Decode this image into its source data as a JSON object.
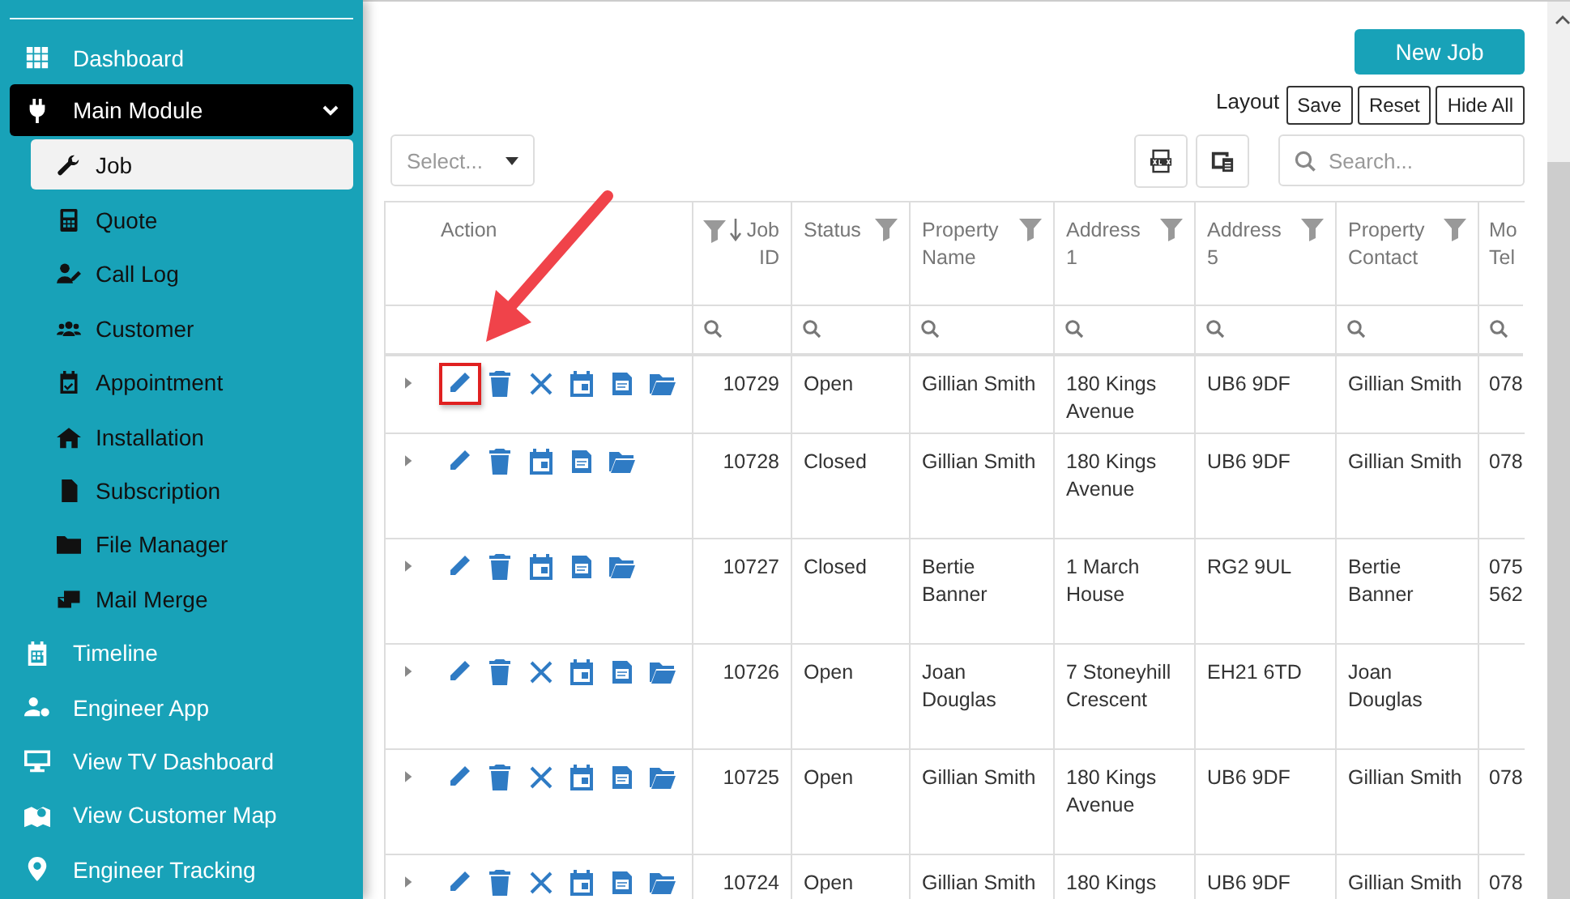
{
  "sidebar": {
    "items": [
      {
        "label": "Dashboard"
      },
      {
        "label": "Main Module",
        "expanded": true,
        "children": [
          {
            "label": "Job",
            "selected": true
          },
          {
            "label": "Quote",
            "selected": false
          },
          {
            "label": "Call Log",
            "selected": false
          },
          {
            "label": "Customer",
            "selected": false
          },
          {
            "label": "Appointment",
            "selected": false
          },
          {
            "label": "Installation",
            "selected": false
          },
          {
            "label": "Subscription",
            "selected": false
          },
          {
            "label": "File Manager",
            "selected": false
          },
          {
            "label": "Mail Merge",
            "selected": false
          }
        ]
      },
      {
        "label": "Timeline"
      },
      {
        "label": "Engineer App"
      },
      {
        "label": "View TV Dashboard"
      },
      {
        "label": "View Customer Map"
      },
      {
        "label": "Engineer Tracking"
      }
    ]
  },
  "toolbar": {
    "new_job": "New Job",
    "layout_label": "Layout",
    "layout_buttons": [
      "Save",
      "Reset",
      "Hide All"
    ],
    "select": {
      "placeholder": "Select..."
    },
    "search": {
      "placeholder": "Search..."
    }
  },
  "table": {
    "action_header": "Action",
    "columns": [
      {
        "label": "Job ID",
        "filterable": true,
        "sorted": true
      },
      {
        "label": "Status",
        "filterable": true,
        "sorted": false
      },
      {
        "label": "Property Name",
        "filterable": true,
        "sorted": false
      },
      {
        "label": "Address 1",
        "filterable": true,
        "sorted": false
      },
      {
        "label": "Address 5",
        "filterable": true,
        "sorted": false
      },
      {
        "label": "Property Contact",
        "filterable": true,
        "sorted": false
      },
      {
        "label": "Mo Tel",
        "filterable": false,
        "sorted": false
      }
    ],
    "rows": [
      {
        "expanded": false,
        "edit_highlighted": true,
        "actions": [
          {
            "kind": "edit"
          },
          {
            "kind": "delete"
          },
          {
            "kind": "cancel"
          },
          {
            "kind": "calendar"
          },
          {
            "kind": "pdf"
          },
          {
            "kind": "folder"
          }
        ],
        "cells": [
          "10729",
          "Open",
          "Gillian Smith",
          "180 Kings Avenue",
          "UB6 9DF",
          "Gillian Smith",
          "078"
        ]
      },
      {
        "expanded": false,
        "edit_highlighted": false,
        "actions": [
          {
            "kind": "edit"
          },
          {
            "kind": "delete"
          },
          {
            "kind": "calendar"
          },
          {
            "kind": "pdf"
          },
          {
            "kind": "folder"
          }
        ],
        "cells": [
          "10728",
          "Closed",
          "Gillian Smith",
          "180 Kings Avenue",
          "UB6 9DF",
          "Gillian Smith",
          "078"
        ]
      },
      {
        "expanded": false,
        "edit_highlighted": false,
        "actions": [
          {
            "kind": "edit"
          },
          {
            "kind": "delete"
          },
          {
            "kind": "calendar"
          },
          {
            "kind": "pdf"
          },
          {
            "kind": "folder"
          }
        ],
        "cells": [
          "10727",
          "Closed",
          "Bertie Banner",
          "1 March House",
          "RG2 9UL",
          "Bertie Banner",
          "075 562"
        ]
      },
      {
        "expanded": false,
        "edit_highlighted": false,
        "actions": [
          {
            "kind": "edit"
          },
          {
            "kind": "delete"
          },
          {
            "kind": "cancel"
          },
          {
            "kind": "calendar"
          },
          {
            "kind": "pdf"
          },
          {
            "kind": "folder"
          }
        ],
        "cells": [
          "10726",
          "Open",
          "Joan Douglas",
          "7 Stoneyhill Crescent",
          "EH21 6TD",
          "Joan Douglas",
          null
        ]
      },
      {
        "expanded": false,
        "edit_highlighted": false,
        "actions": [
          {
            "kind": "edit"
          },
          {
            "kind": "delete"
          },
          {
            "kind": "cancel"
          },
          {
            "kind": "calendar"
          },
          {
            "kind": "pdf"
          },
          {
            "kind": "folder"
          }
        ],
        "cells": [
          "10725",
          "Open",
          "Gillian Smith",
          "180 Kings Avenue",
          "UB6 9DF",
          "Gillian Smith",
          "078"
        ]
      },
      {
        "expanded": false,
        "edit_highlighted": false,
        "actions": [
          {
            "kind": "edit"
          },
          {
            "kind": "delete"
          },
          {
            "kind": "cancel"
          },
          {
            "kind": "calendar"
          },
          {
            "kind": "pdf"
          },
          {
            "kind": "folder"
          }
        ],
        "cells": [
          "10724",
          "Open",
          "Gillian Smith",
          "180 Kings",
          "UB6 9DF",
          "Gillian Smith",
          "078"
        ]
      }
    ]
  }
}
